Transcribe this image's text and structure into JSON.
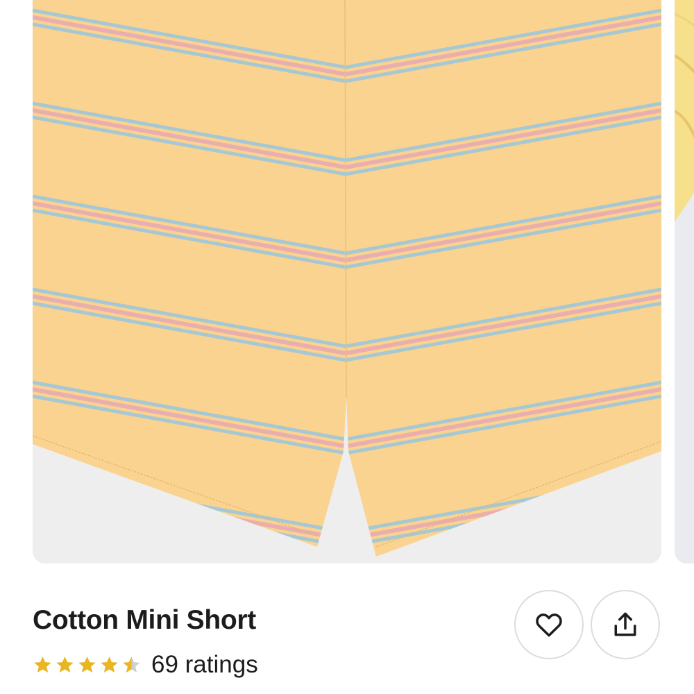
{
  "product": {
    "title": "Cotton Mini Short",
    "rating_value": 4.5,
    "rating_max": 5,
    "ratings_label": "69 ratings"
  },
  "icons": {
    "favorite": "heart-icon",
    "share": "share-icon",
    "star": "star-icon"
  },
  "colors": {
    "fabric": "#f9d38f",
    "stripe_pink": "#eaaeae",
    "stripe_blue": "#a6c8d4",
    "star_gold": "#e9b620",
    "star_empty": "#cfcfcf",
    "photo_bg": "#eeeeee"
  }
}
